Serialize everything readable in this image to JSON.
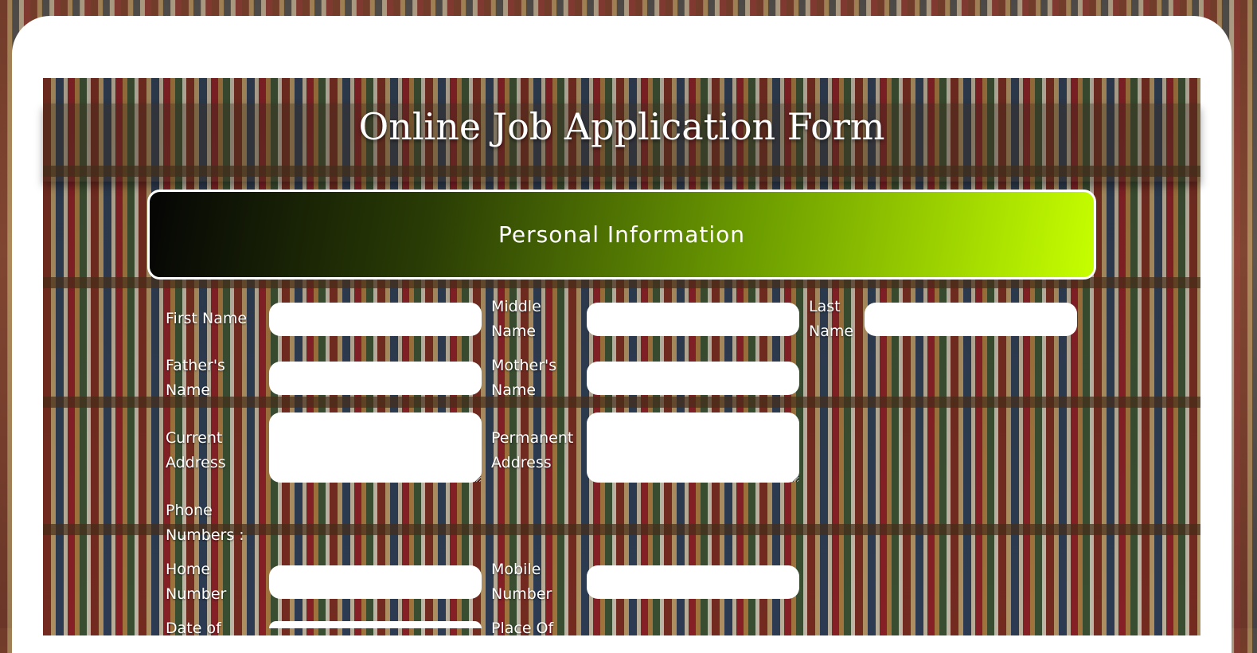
{
  "form": {
    "title": "Online Job Application Form",
    "section_title": "Personal Information",
    "labels": {
      "first_name": "First Name",
      "middle_name": "Middle Name",
      "last_name": "Last Name",
      "fathers_name": "Father's Name",
      "mothers_name": "Mother's Name",
      "current_address": "Current Address",
      "permanent_address": "Permanent Address",
      "phone_numbers": "Phone Numbers :",
      "home_number": "Home Number",
      "mobile_number": "Mobile Number",
      "date_of": "Date of",
      "place_of": "Place Of"
    },
    "values": {
      "first_name": "",
      "middle_name": "",
      "last_name": "",
      "fathers_name": "",
      "mothers_name": "",
      "current_address": "",
      "permanent_address": "",
      "home_number": "",
      "mobile_number": ""
    }
  },
  "colors": {
    "banner_start": "#050505",
    "banner_end": "#c6ff00",
    "field_bg": "#ffffff",
    "frame_bg": "#ffffff"
  }
}
